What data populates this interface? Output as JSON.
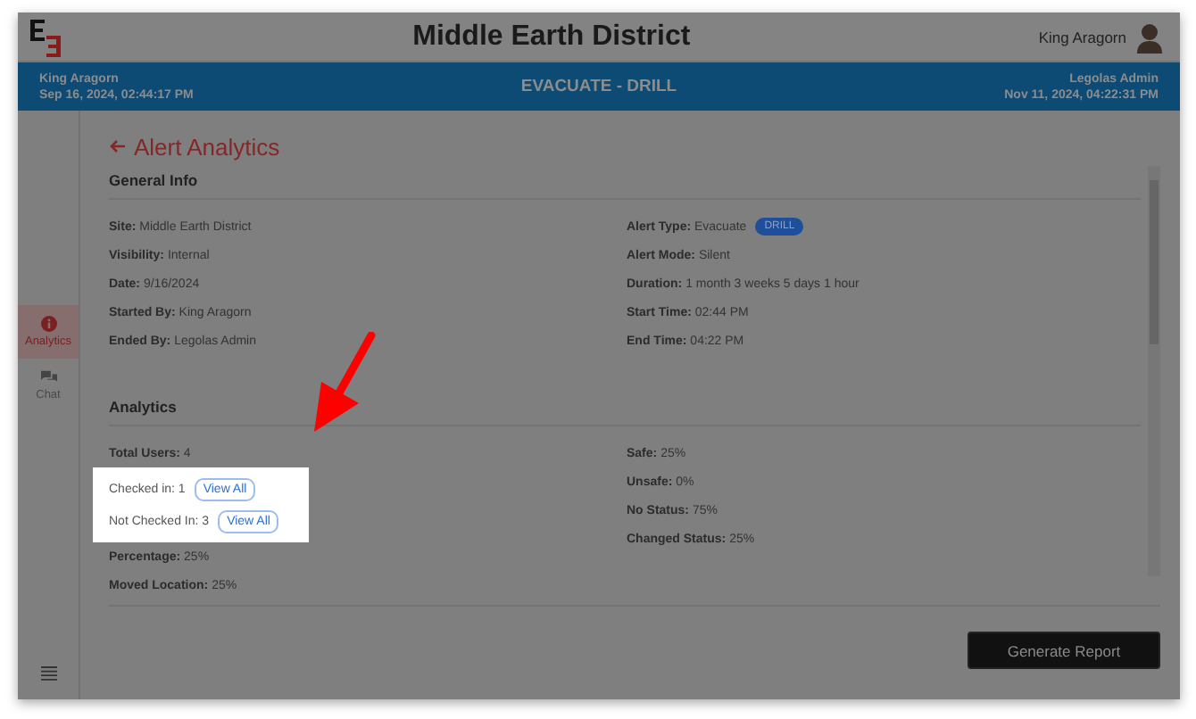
{
  "header": {
    "title": "Middle Earth District",
    "user": "King Aragorn"
  },
  "alert_bar": {
    "started_by": "King Aragorn",
    "started_at": "Sep 16, 2024, 02:44:17 PM",
    "title": "EVACUATE - DRILL",
    "ended_by": "Legolas Admin",
    "ended_at": "Nov 11, 2024, 04:22:31 PM"
  },
  "sidebar": {
    "items": [
      {
        "label": "Analytics",
        "selected": true
      },
      {
        "label": "Chat",
        "selected": false
      }
    ]
  },
  "page_title": "Alert Analytics",
  "general_info": {
    "heading": "General Info",
    "left": [
      {
        "label": "Site:",
        "value": "Middle Earth District"
      },
      {
        "label": "Visibility:",
        "value": "Internal"
      },
      {
        "label": "Date:",
        "value": "9/16/2024"
      },
      {
        "label": "Started By:",
        "value": "King Aragorn"
      },
      {
        "label": "Ended By:",
        "value": "Legolas Admin"
      }
    ],
    "right": [
      {
        "label": "Alert Type:",
        "value": "Evacuate",
        "badge": "DRILL"
      },
      {
        "label": "Alert Mode:",
        "value": "Silent"
      },
      {
        "label": "Duration:",
        "value": "1 month 3 weeks 5 days 1 hour"
      },
      {
        "label": "Start Time:",
        "value": "02:44 PM"
      },
      {
        "label": "End Time:",
        "value": "04:22 PM"
      }
    ]
  },
  "analytics": {
    "heading": "Analytics",
    "left": [
      {
        "label": "Total Users:",
        "value": "4",
        "highlighted": false
      },
      {
        "label": "Checked in:",
        "value": "1",
        "button": "View All",
        "highlighted": true
      },
      {
        "label": "Not Checked In:",
        "value": "3",
        "button": "View All",
        "highlighted": true
      },
      {
        "label": "Percentage:",
        "value": "25%",
        "highlighted": false
      },
      {
        "label": "Moved Location:",
        "value": "25%",
        "highlighted": false
      }
    ],
    "right": [
      {
        "label": "Safe:",
        "value": "25%"
      },
      {
        "label": "Unsafe:",
        "value": "0%"
      },
      {
        "label": "No Status:",
        "value": "75%"
      },
      {
        "label": "Changed Status:",
        "value": "25%"
      }
    ]
  },
  "footer": {
    "button": "Generate Report"
  }
}
